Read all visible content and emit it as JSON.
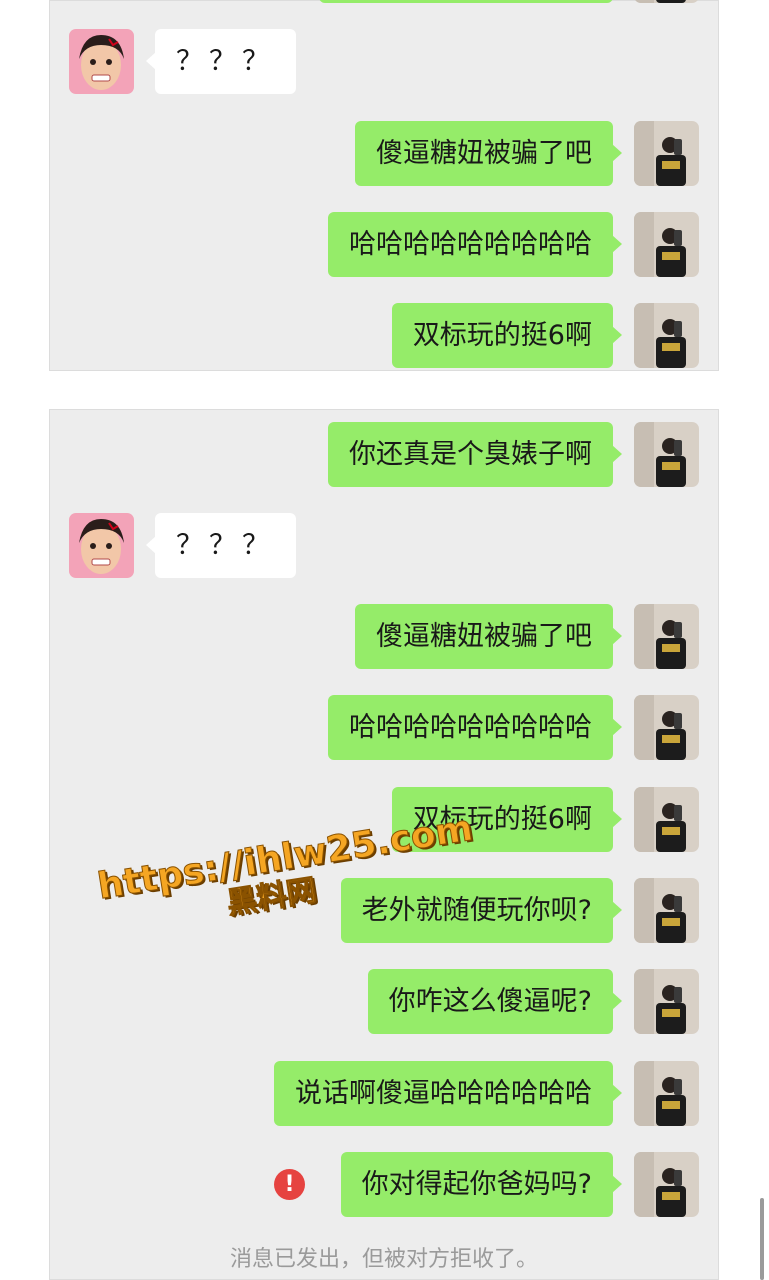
{
  "panel1": {
    "messages": [
      {
        "side": "in",
        "text": "？？？",
        "avatar": "female-avatar"
      },
      {
        "side": "out",
        "text": "傻逼糖妞被骗了吧",
        "avatar": "male-avatar"
      },
      {
        "side": "out",
        "text": "哈哈哈哈哈哈哈哈哈",
        "avatar": "male-avatar"
      },
      {
        "side": "out",
        "text": "双标玩的挺6啊",
        "avatar": "male-avatar"
      }
    ]
  },
  "panel2": {
    "messages": [
      {
        "side": "out",
        "text": "你还真是个臭婊子啊",
        "avatar": "male-avatar"
      },
      {
        "side": "in",
        "text": "？？？",
        "avatar": "female-avatar"
      },
      {
        "side": "out",
        "text": "傻逼糖妞被骗了吧",
        "avatar": "male-avatar"
      },
      {
        "side": "out",
        "text": "哈哈哈哈哈哈哈哈哈",
        "avatar": "male-avatar"
      },
      {
        "side": "out",
        "text": "双标玩的挺6啊",
        "avatar": "male-avatar"
      },
      {
        "side": "out",
        "text": "老外就随便玩你呗?",
        "avatar": "male-avatar"
      },
      {
        "side": "out",
        "text": "你咋这么傻逼呢?",
        "avatar": "male-avatar"
      },
      {
        "side": "out",
        "text": "说话啊傻逼哈哈哈哈哈哈",
        "avatar": "male-avatar"
      },
      {
        "side": "out",
        "text": "你对得起你爸妈吗?",
        "avatar": "male-avatar",
        "status": "rejected",
        "status_icon": "error-icon"
      }
    ],
    "system_note": "消息已发出，但被对方拒收了。"
  },
  "watermark": {
    "url": "https://ihlw25.com",
    "name": "黑料网"
  },
  "colors": {
    "outgoing_bubble": "#95ec69",
    "incoming_bubble": "#ffffff",
    "chat_background": "#ededed",
    "error": "#e64340"
  }
}
